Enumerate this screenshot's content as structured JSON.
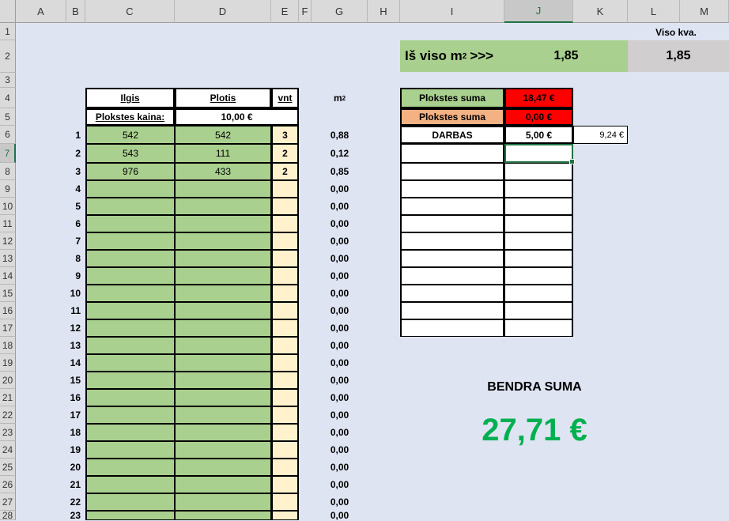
{
  "columns": [
    "A",
    "B",
    "C",
    "D",
    "E",
    "F",
    "G",
    "H",
    "I",
    "J",
    "K",
    "L",
    "M"
  ],
  "rows": [
    "1",
    "2",
    "3",
    "4",
    "5",
    "6",
    "7",
    "8",
    "9",
    "10",
    "11",
    "12",
    "13",
    "14",
    "15",
    "16",
    "17",
    "18",
    "19",
    "20",
    "21",
    "22",
    "23",
    "24",
    "25",
    "26",
    "27",
    "28"
  ],
  "selected_cell": "J7",
  "summary": {
    "total_label": "Viso kva.",
    "total_m2_label": "Iš viso m",
    "superscript": "2",
    "arrows": ">>>",
    "total_m2_value": "1,85",
    "total_kva_value": "1,85"
  },
  "input_table": {
    "header_length": "Ilgis",
    "header_width": "Plotis",
    "header_qty": "vnt",
    "m2_header": "m",
    "m2_sup": "2",
    "price_label": "Plokstes kaina:",
    "price_value": "10,00 €",
    "items": [
      {
        "num": "1",
        "length": "542",
        "width": "542",
        "qty": "3",
        "m2": "0,88"
      },
      {
        "num": "2",
        "length": "543",
        "width": "111",
        "qty": "2",
        "m2": "0,12"
      },
      {
        "num": "3",
        "length": "976",
        "width": "433",
        "qty": "2",
        "m2": "0,85"
      },
      {
        "num": "4",
        "length": "",
        "width": "",
        "qty": "",
        "m2": "0,00"
      },
      {
        "num": "5",
        "length": "",
        "width": "",
        "qty": "",
        "m2": "0,00"
      },
      {
        "num": "6",
        "length": "",
        "width": "",
        "qty": "",
        "m2": "0,00"
      },
      {
        "num": "7",
        "length": "",
        "width": "",
        "qty": "",
        "m2": "0,00"
      },
      {
        "num": "8",
        "length": "",
        "width": "",
        "qty": "",
        "m2": "0,00"
      },
      {
        "num": "9",
        "length": "",
        "width": "",
        "qty": "",
        "m2": "0,00"
      },
      {
        "num": "10",
        "length": "",
        "width": "",
        "qty": "",
        "m2": "0,00"
      },
      {
        "num": "11",
        "length": "",
        "width": "",
        "qty": "",
        "m2": "0,00"
      },
      {
        "num": "12",
        "length": "",
        "width": "",
        "qty": "",
        "m2": "0,00"
      },
      {
        "num": "13",
        "length": "",
        "width": "",
        "qty": "",
        "m2": "0,00"
      },
      {
        "num": "14",
        "length": "",
        "width": "",
        "qty": "",
        "m2": "0,00"
      },
      {
        "num": "15",
        "length": "",
        "width": "",
        "qty": "",
        "m2": "0,00"
      },
      {
        "num": "16",
        "length": "",
        "width": "",
        "qty": "",
        "m2": "0,00"
      },
      {
        "num": "17",
        "length": "",
        "width": "",
        "qty": "",
        "m2": "0,00"
      },
      {
        "num": "18",
        "length": "",
        "width": "",
        "qty": "",
        "m2": "0,00"
      },
      {
        "num": "19",
        "length": "",
        "width": "",
        "qty": "",
        "m2": "0,00"
      },
      {
        "num": "20",
        "length": "",
        "width": "",
        "qty": "",
        "m2": "0,00"
      },
      {
        "num": "21",
        "length": "",
        "width": "",
        "qty": "",
        "m2": "0,00"
      },
      {
        "num": "22",
        "length": "",
        "width": "",
        "qty": "",
        "m2": "0,00"
      },
      {
        "num": "23",
        "length": "",
        "width": "",
        "qty": "",
        "m2": "0,00"
      }
    ]
  },
  "cost_table": {
    "rows": [
      {
        "label": "Plokstes suma",
        "value": "18,47 €",
        "label_color": "#a9d08e",
        "value_color": "#ff0000"
      },
      {
        "label": "Plokstes suma",
        "value": "0,00 €",
        "label_color": "#f4b183",
        "value_color": "#ff0000"
      },
      {
        "label": "DARBAS",
        "value": "5,00 €",
        "extra": "9,24 €"
      }
    ],
    "empty_rows": 11
  },
  "grand_total": {
    "label": "BENDRA SUMA",
    "value": "27,71 €",
    "color": "#00b050"
  }
}
